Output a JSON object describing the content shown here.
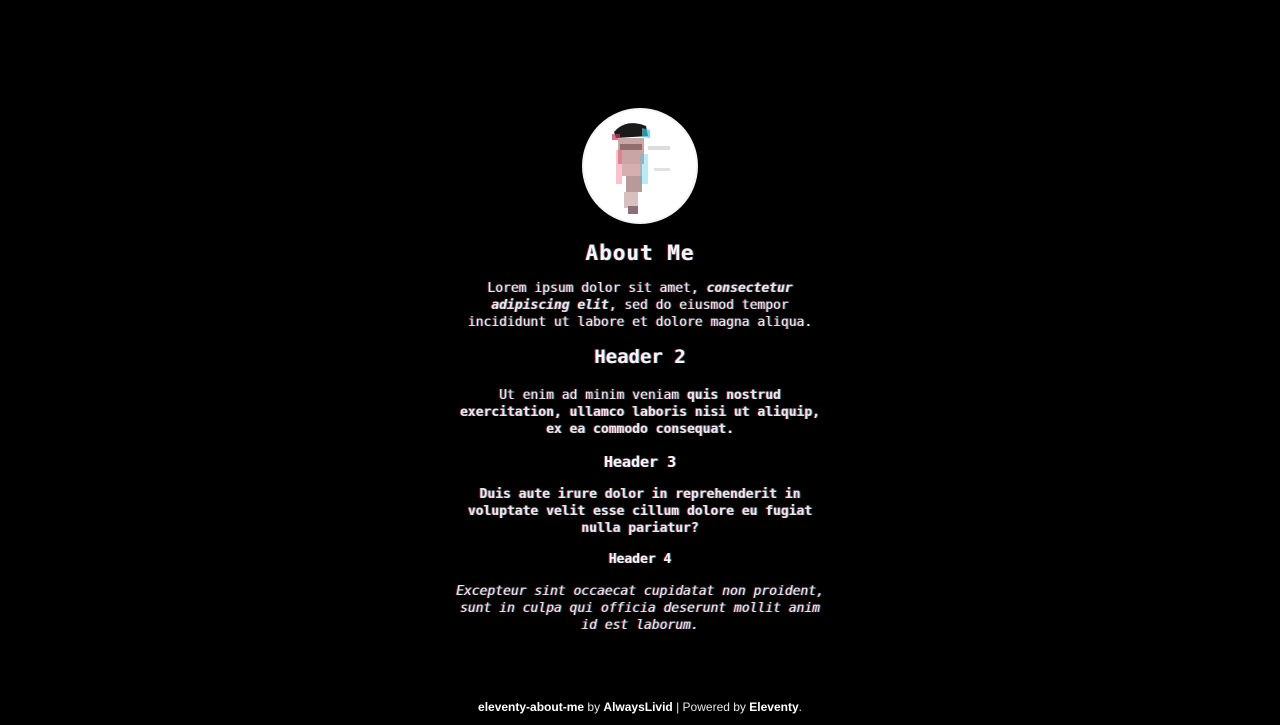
{
  "profile": {
    "avatar_alt": "profile-photo"
  },
  "about": {
    "title": "About Me",
    "paragraph": {
      "text_before": "Lorem ipsum dolor sit amet, ",
      "emphasis": "consectetur adipiscing elit",
      "text_after": ", sed do eiusmod tempor incididunt ut labore et dolore magna aliqua."
    }
  },
  "section2": {
    "title": "Header 2",
    "paragraph": {
      "text_before": "Ut enim ad minim veniam ",
      "bold": "quis nostrud exercitation, ullamco laboris nisi ut aliquip, ex ea commodo consequat."
    }
  },
  "section3": {
    "title": "Header 3",
    "paragraph": "Duis aute irure dolor in reprehenderit in voluptate velit esse cillum dolore eu fugiat nulla pariatur?"
  },
  "section4": {
    "title": "Header 4",
    "paragraph": "Excepteur sint occaecat cupidatat non proident, sunt in culpa qui officia deserunt mollit anim id est laborum."
  },
  "footer": {
    "project": "eleventy-about-me",
    "by": " by ",
    "author": "AlwaysLivid",
    "separator": " | Powered by ",
    "powered": "Eleventy",
    "end": "."
  }
}
